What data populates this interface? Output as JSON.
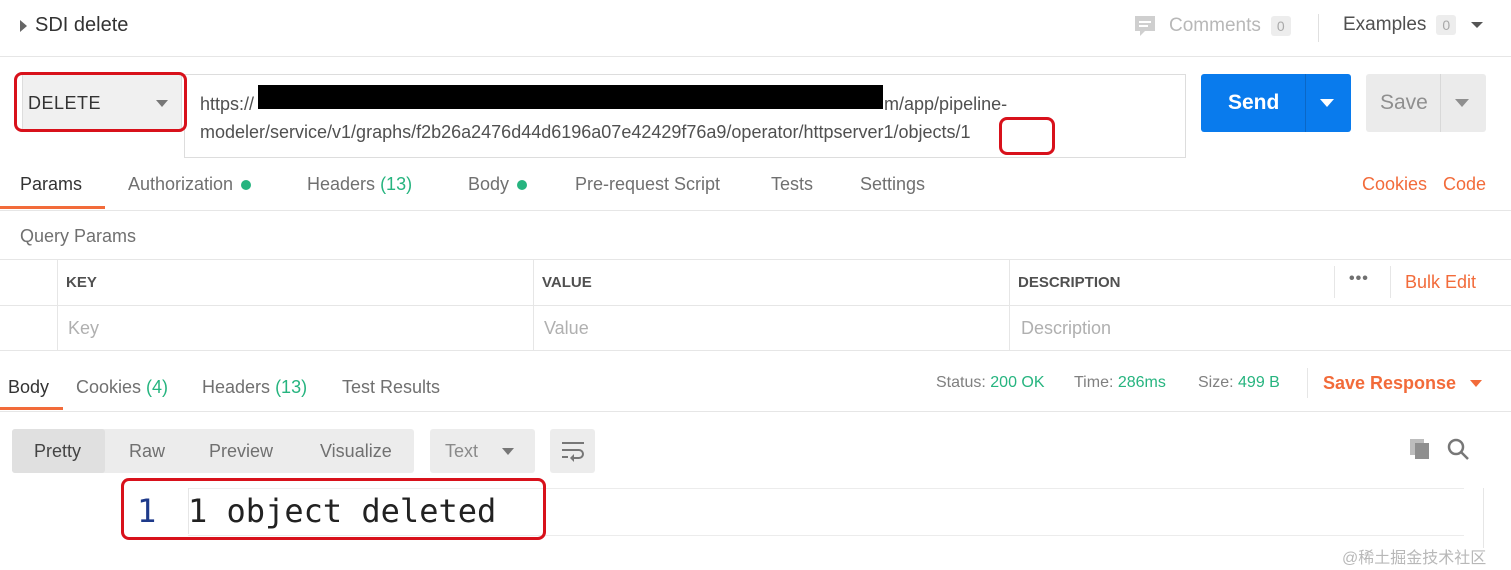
{
  "header": {
    "title": "SDI delete",
    "comments_label": "Comments",
    "comments_count": "0",
    "examples_label": "Examples",
    "examples_count": "0"
  },
  "request": {
    "method": "DELETE",
    "url_line1_prefix": "https://",
    "url_line1_suffix": "m/app/pipeline-",
    "url_line2": "modeler/service/v1/graphs/f2b26a2476d44d6196a07e42429f76a9/operator/httpserver1/objects/1",
    "send_label": "Send",
    "save_label": "Save"
  },
  "request_tabs": {
    "params": "Params",
    "authorization": "Authorization",
    "headers": "Headers",
    "headers_count": "(13)",
    "body": "Body",
    "prerequest": "Pre-request Script",
    "tests": "Tests",
    "settings": "Settings",
    "cookies": "Cookies",
    "code": "Code"
  },
  "query_params": {
    "title": "Query Params",
    "col_key": "KEY",
    "col_value": "VALUE",
    "col_description": "DESCRIPTION",
    "more": "•••",
    "bulk_edit": "Bulk Edit",
    "key_placeholder": "Key",
    "value_placeholder": "Value",
    "description_placeholder": "Description"
  },
  "response": {
    "tabs": {
      "body": "Body",
      "cookies": "Cookies",
      "cookies_count": "(4)",
      "headers": "Headers",
      "headers_count": "(13)",
      "test_results": "Test Results"
    },
    "status_label": "Status:",
    "status_value": "200 OK",
    "time_label": "Time:",
    "time_value": "286ms",
    "size_label": "Size:",
    "size_value": "499 B",
    "save_response": "Save Response",
    "views": [
      "Pretty",
      "Raw",
      "Preview",
      "Visualize"
    ],
    "format": "Text",
    "line_number": "1",
    "body_line": "1 object deleted"
  },
  "watermark": "@稀土掘金技术社区",
  "colors": {
    "accent": "#f26b3a",
    "send_blue": "#097bed",
    "success_green": "#26b47f",
    "annotation_red": "#d8111b"
  }
}
